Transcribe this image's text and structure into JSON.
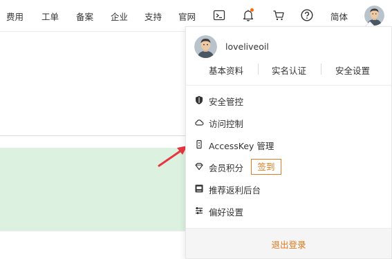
{
  "nav": {
    "items": [
      "费用",
      "工单",
      "备案",
      "企业",
      "支持",
      "官网"
    ],
    "icons": [
      "terminal-icon",
      "bell-icon",
      "cart-icon",
      "help-icon"
    ],
    "language": "简体",
    "notification_dot_color": "#ff6a00"
  },
  "user_menu": {
    "username": "loveliveoil",
    "tabs": [
      "基本资料",
      "实名认证",
      "安全设置"
    ],
    "items": [
      {
        "icon": "shield-icon",
        "label": "安全管控"
      },
      {
        "icon": "cloud-icon",
        "label": "访问控制"
      },
      {
        "icon": "key-icon",
        "label": "AccessKey 管理"
      },
      {
        "icon": "diamond-icon",
        "label": "会员积分"
      },
      {
        "icon": "gift-icon",
        "label": "推荐返利后台"
      },
      {
        "icon": "sliders-icon",
        "label": "偏好设置"
      }
    ],
    "checkin_label": "签到",
    "logout_label": "退出登录",
    "accent_color": "#e07a1f"
  },
  "colors": {
    "annotation_arrow": "#e8353f",
    "background_panel": "#dcf1e0"
  }
}
